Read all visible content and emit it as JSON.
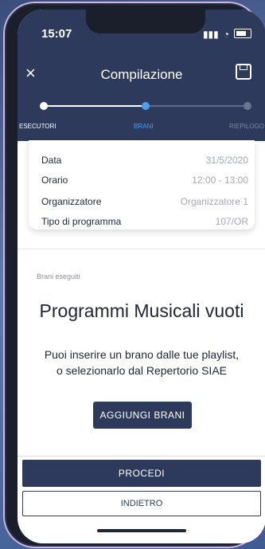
{
  "status_bar": {
    "time": "15:07"
  },
  "header": {
    "title": "Compilazione",
    "close_glyph": "×"
  },
  "stepper": {
    "steps": [
      {
        "label": "ESECUTORI",
        "state": "done"
      },
      {
        "label": "BRANI",
        "state": "active"
      },
      {
        "label": "RIEPILOGO",
        "state": "todo"
      }
    ]
  },
  "details": {
    "rows": [
      {
        "key": "Data",
        "value": "31/5/2020"
      },
      {
        "key": "Orario",
        "value": "12:00 - 13:00"
      },
      {
        "key": "Organizzatore",
        "value": "Organizzatore 1"
      },
      {
        "key": "Tipo di programma",
        "value": "107/OR"
      }
    ]
  },
  "section": {
    "label": "Brani eseguiti"
  },
  "empty_state": {
    "title": "Programmi Musicali vuoti",
    "description": "Puoi inserire un brano dalle tue playlist, o selezionarlo dal Repertorio SIAE",
    "add_button": "AGGIUNGI BRANI"
  },
  "footer": {
    "proceed": "PROCEDI",
    "back": "INDIETRO"
  },
  "colors": {
    "primary": "#2e3a5b",
    "accent": "#4b9ef0"
  }
}
